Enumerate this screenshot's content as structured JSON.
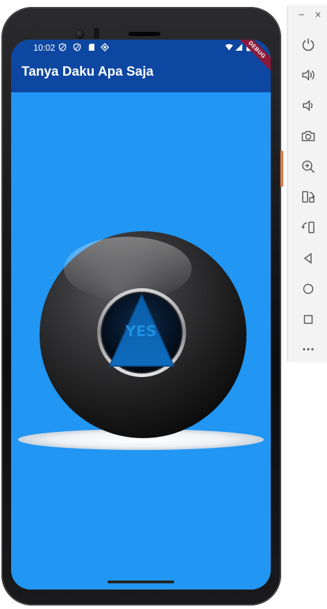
{
  "status_bar": {
    "time": "10:02",
    "left_icons": [
      "shield-icon",
      "shield-icon",
      "sd-card-icon",
      "tag-icon"
    ],
    "right_icons": [
      "wifi-icon",
      "signal-icon",
      "battery-icon"
    ]
  },
  "app": {
    "title": "Tanya Daku Apa Saja",
    "debug_label": "DEBUG",
    "answer": "YES"
  },
  "colors": {
    "appbar": "#0d47a1",
    "background": "#2196f3",
    "answer_text": "#1e8fe0"
  },
  "emulator_toolbar": {
    "window_controls": [
      "minimize-icon",
      "close-icon"
    ],
    "minimize_label": "−",
    "close_label": "×",
    "buttons": [
      "power-icon",
      "volume-up-icon",
      "volume-down-icon",
      "camera-icon",
      "zoom-icon",
      "rotate-left-icon",
      "rotate-right-icon",
      "back-icon",
      "home-icon",
      "overview-icon",
      "more-icon"
    ]
  }
}
